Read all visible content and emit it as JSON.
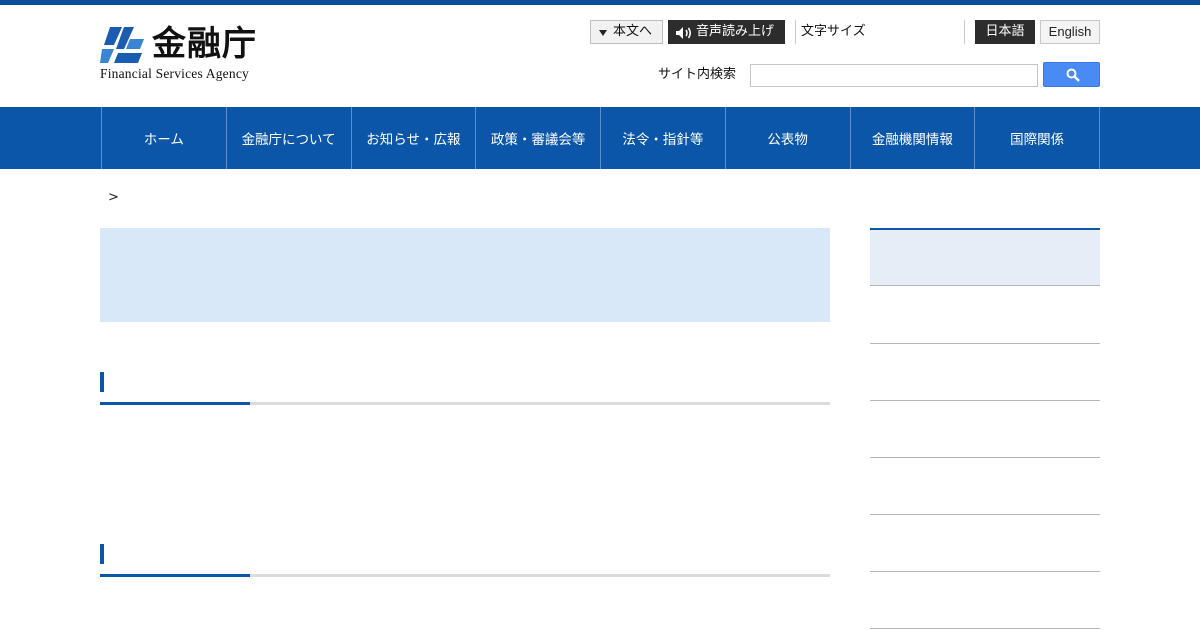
{
  "brand": {
    "name_ja": "金融庁",
    "name_en": "Financial Services Agency",
    "color": "#0b56a8"
  },
  "utility": {
    "skip_label": "本文へ",
    "skip_icon": "triangle-down-icon",
    "voice_label": "音声読み上げ",
    "voice_icon": "speaker-icon",
    "font_size_label": "文字サイズ",
    "lang_ja": "日本語",
    "lang_en": "English"
  },
  "search": {
    "label": "サイト内検索",
    "placeholder": "",
    "button_icon": "search-icon"
  },
  "nav": {
    "items": [
      {
        "label": "ホーム"
      },
      {
        "label": "金融庁について"
      },
      {
        "label": "お知らせ・広報"
      },
      {
        "label": "政策・審議会等"
      },
      {
        "label": "法令・指針等"
      },
      {
        "label": "公表物"
      },
      {
        "label": "金融機関情報"
      },
      {
        "label": "国際関係"
      }
    ]
  },
  "breadcrumb": {
    "separator": ">"
  },
  "colors": {
    "hero_bg": "#d8e8f8",
    "sidebar_head_bg": "#e6edf6",
    "dark_button": "#2c2c2c",
    "search_button": "#4a8af4"
  }
}
